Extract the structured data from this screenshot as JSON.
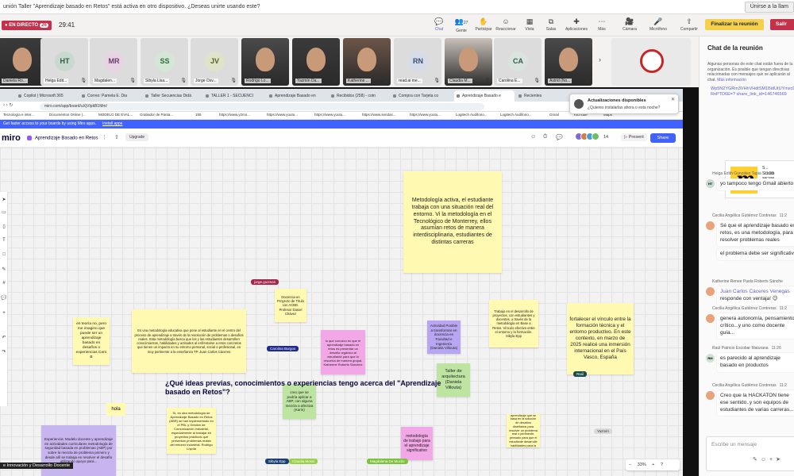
{
  "banner": {
    "text": "unión Taller \"Aprendizaje basado en Retos\" está activa en otro dispositivo. ¿Deseas unirte usando este?",
    "button": "Únirse a la llam"
  },
  "toolbar": {
    "live_label": "EN DIRECTO",
    "live_count": "26",
    "timer": "29:41",
    "buttons": [
      {
        "label": "Chat",
        "icon": "chat-icon"
      },
      {
        "label": "Gente",
        "count": "27",
        "icon": "people-icon"
      },
      {
        "label": "Participar",
        "icon": "raise-hand-icon"
      },
      {
        "label": "Reaccionar",
        "icon": "reaction-icon"
      },
      {
        "label": "Vista",
        "icon": "view-icon"
      },
      {
        "label": "Salas",
        "icon": "rooms-icon"
      },
      {
        "label": "Aplicaciones",
        "icon": "apps-icon"
      },
      {
        "label": "Más",
        "icon": "more-icon"
      },
      {
        "label": "Cámara",
        "icon": "camera-icon"
      },
      {
        "label": "Micrófono",
        "icon": "mic-icon"
      },
      {
        "label": "Compartir",
        "icon": "share-screen-icon"
      }
    ],
    "finish": "Finalizar la reunión",
    "leave": "Salir"
  },
  "participants": [
    {
      "name": "Daniela Ro...",
      "initials": "",
      "video": true
    },
    {
      "name": "Helga Edit...",
      "initials": "HT",
      "color": "#c8d9d0",
      "fg": "#2f5c46"
    },
    {
      "name": "Magdalen...",
      "initials": "MR",
      "color": "#e8d3e5",
      "fg": "#6d3b66"
    },
    {
      "name": "Sibyla Lisa...",
      "initials": "SS",
      "color": "#d3e7d6",
      "fg": "#2d6a3a"
    },
    {
      "name": "Jorge Osv...",
      "initials": "JV",
      "color": "#dfe3c8",
      "fg": "#5a6127"
    },
    {
      "name": "Rodrigo Lo...",
      "initials": "",
      "video": true
    },
    {
      "name": "Yazmín Da...",
      "initials": "",
      "video": true
    },
    {
      "name": "Katherine ...",
      "initials": "",
      "video": true
    },
    {
      "name": "read.ai me...",
      "initials": "RN",
      "color": "#d5dbe8",
      "fg": "#3a4b72"
    },
    {
      "name": "Claudia M...",
      "initials": "",
      "video": true
    },
    {
      "name": "Carolina E...",
      "initials": "CA",
      "color": "#d9e4df",
      "fg": "#355a4a"
    },
    {
      "name": "Astrid (No...",
      "initials": "",
      "video": true
    }
  ],
  "browser": {
    "tabs": [
      "Copilot | Microsoft 365",
      "Correo: Pamela E. Dia",
      "Taller Secuencias Didá",
      "TALLER 1 - SECUENCI",
      "Aprendizaje Basado en",
      "Recibidos (258) - cotn",
      "Compra con Tarjeta co",
      "Aprendizaje Basado e",
      "Recientes"
    ],
    "active_tab": "Aprendizaje Basado e",
    "url": "miro.com/app/board/uXjVIpkB1Mm/",
    "bookmarks": [
      "Tecnología e inter...",
      "Documentos Online |...",
      "MODELO DE EVAL...",
      "Grabador de Panta...",
      "155",
      "https://www.y2mo...",
      "https://www.youtu...",
      "https://www.youtu...",
      "https://www.seridas...",
      "https://www.youtu...",
      "Logitech Audifono...",
      "Logitech Audifono...",
      "Gmail",
      "YouTube",
      "Maps"
    ],
    "update_title": "Actualizaciones disponibles",
    "update_sub": "¿Quieres instalarlas ahora o esta noche?"
  },
  "miro": {
    "promo": "Get faster access to your boards by using Miro apps.",
    "promo_link": "Install apps",
    "logo": "miro",
    "board": "Aprendizaje Basado en Retos",
    "upgrade": "Upgrade",
    "collab_count": "14",
    "present": "Present",
    "share": "Share",
    "zoom": "33%",
    "question": "¿Qué ideas previas, conocimientos o experiencias tengo acerca del \"Aprendizaje basado en Retos\"?",
    "hola": "hola",
    "footer_name": "e Innovación y Desarrollo Docente",
    "notes": [
      {
        "id": "n1",
        "color": "yellow",
        "text": "Metodología activa, el estudiante trabaja con una situación real del entorno. Vi la metodología en el Tecnológico de Monterrey, ellos asumían retos de manera interdisciplinaria, estudiantes de distintas carreras"
      },
      {
        "id": "n2",
        "color": "yellow",
        "text": "en teoría no, pero me imagino que puede ser un aprendizaje basado en desafíos o experiencias Caro B"
      },
      {
        "id": "n3",
        "color": "yellow",
        "text": "Es una metodología educativa que pone al estudiante en el centro del proceso de aprendizaje a través de la resolución de problemas o desafíos reales. Esta metodología busca que los y las estudiantes desarrollen conocimientos, habilidades y actitudes al enfrentarse a retos concretos que tienen un impacto en su entorno personal, social o profesional, en muy pertinente a la enseñanza TP. Juan Carlos Cáceres"
      },
      {
        "id": "n4",
        "color": "yellow",
        "text": "Docencia en Proyecto de Título con ACBD. Profesor Daniel Chávez"
      },
      {
        "id": "n5",
        "color": "pink",
        "text": "lo que conozco es que el aprendizaje basado en retos es presentar un desafío orgánico al estudiante para que lo resuelva de manera grupal. Katherine Roberts Sánchez"
      },
      {
        "id": "n6",
        "color": "lavender",
        "text": "Actividad Posible a transformar en docencia en Facultad e Ingeniería (Daniela Villouta)"
      },
      {
        "id": "n7",
        "color": "yellow",
        "text": "Trabajo en el desarrollo de proyectos, con estudiantes y docentes, a través de la metodología en Base a Retos. Vínculo efectivo entre el entorno y la formación. Sibyla Epp"
      },
      {
        "id": "n8",
        "color": "yellow",
        "text": "fortalecer el vínculo entre la formación técnica y el entorno productivo. En este contexto, en marzo de 2025 realicé una inmersión internacional en el País Vasco, España"
      },
      {
        "id": "n9",
        "color": "green",
        "text": "Taller de arquitectura (Daniela Villouta)"
      },
      {
        "id": "n10",
        "color": "green",
        "text": "creo que se podría aplicar a ABP, con alguna mezcla a afectiva (Karin)"
      },
      {
        "id": "n11",
        "color": "yellow",
        "text": "Sí, es otra metodología de Aprendizaje Basado en Retos (ABR) se han implementado en el PBL y Gestión de Comunicación Industrial, especialmente al trabajar en proyectos prácticos que presentan problemas reales del entorno industrial. Rodrigo Loyola"
      },
      {
        "id": "n12",
        "color": "pink",
        "text": "metodología de trabajo para el aprendizaje significativo"
      },
      {
        "id": "n13",
        "color": "yellow",
        "text": "Metodología de aprendizaje que se basa en la solución de desafíos diseñados para resolver un problema real o pertinente, pensado para que el estudiante desarrolle habilidades para la vida y su profesión"
      },
      {
        "id": "n14",
        "color": "purple",
        "text": "Experiencia: Modelo docente y aprendizaje en actividades curriculares metodología de seguridad basada en problemas (ABP) por sobre la mezcla de problema primero y desde allí se trabaja en resolver el desafío utilizando apoyo para..."
      }
    ],
    "cursors": [
      {
        "name": "jorge.guzman",
        "color": "#a3264b"
      },
      {
        "name": "Carolina Burgos",
        "color": "#1f2a8a"
      },
      {
        "name": "Raúl",
        "color": "#1b4c4a"
      },
      {
        "name": "Sibyla Epp",
        "color": "#1b3f73"
      },
      {
        "name": "Claudia Moral",
        "color": "#9acf4a"
      },
      {
        "name": "Magdalena De Mucilo",
        "color": "#7dc23f"
      },
      {
        "name": "Yazmín",
        "color": "#d9d9d9"
      }
    ]
  },
  "chat": {
    "title": "Chat de la reunión",
    "notice": "Algunas personas de este chat están fuera de tu organización. Es posible que tengan directivas relacionadas con mensajes que se aplicarán al chat.",
    "notice_link": "Más información",
    "link_text": "Wp5N2YGRm3VHhVHdtSM1BidUtUYmxcDRnPTD6E=? share_link_id=146746569",
    "preview_title": "S...",
    "preview_sub1": "Scalab",
    "preview_sub2": "secure",
    "messages": [
      {
        "author": "Helga Edith González Tapia",
        "time": "11:20",
        "initials": "HT",
        "color": "#c8d9d0",
        "texts": [
          "yo tampoco tengo Gmail abierto"
        ]
      },
      {
        "author": "Cecilia Angélica Gutiérrez Contreras",
        "time": "11:2",
        "initials": "",
        "color": "#e8a37a",
        "texts": [
          "Sé que el aprendizaje basado en retos, es una metodología, para resolver problemas reales",
          "el problema debe ser significativo"
        ]
      },
      {
        "author": "Katherine Renee Paola Roberts Sánche",
        "time": "",
        "initials": "",
        "color": "#e8a37a",
        "mention": "Juan Carlos Cáceres Venegas",
        "texts": [
          "responde con ventaja! 😉"
        ]
      },
      {
        "author": "Cecilia Angélica Gutiérrez Contreras",
        "time": "11:2",
        "initials": "",
        "color": "#e8a37a",
        "texts": [
          "genera autonomía, pensamiento crítico...y uno como docente guía..."
        ]
      },
      {
        "author": "Raúl Patricio Escobar Maturana",
        "time": "11:26",
        "initials": "RM",
        "color": "#cfe3d4",
        "texts": [
          "es parecido al aprendizaje basado en productos"
        ]
      },
      {
        "author": "Cecilia Angélica Gutiérrez Contreras",
        "time": "11:2",
        "initials": "",
        "color": "#e8a37a",
        "texts": [
          "Creo que la HACKATON tiene ese sentido..y son equipos de estudiantes de varias carreras..."
        ]
      }
    ],
    "input_placeholder": "Escribe un mensaje"
  }
}
